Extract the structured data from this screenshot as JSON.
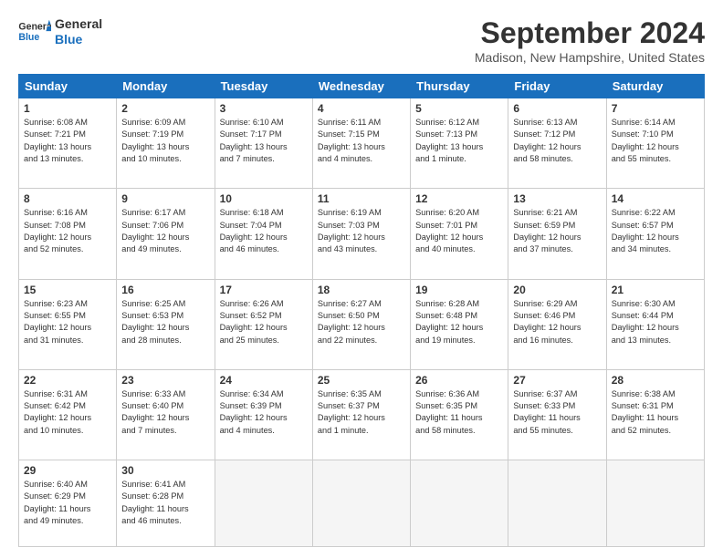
{
  "header": {
    "logo_line1": "General",
    "logo_line2": "Blue",
    "month_title": "September 2024",
    "location": "Madison, New Hampshire, United States"
  },
  "days_of_week": [
    "Sunday",
    "Monday",
    "Tuesday",
    "Wednesday",
    "Thursday",
    "Friday",
    "Saturday"
  ],
  "weeks": [
    [
      {
        "day": 1,
        "data": "Sunrise: 6:08 AM\nSunset: 7:21 PM\nDaylight: 13 hours\nand 13 minutes."
      },
      {
        "day": 2,
        "data": "Sunrise: 6:09 AM\nSunset: 7:19 PM\nDaylight: 13 hours\nand 10 minutes."
      },
      {
        "day": 3,
        "data": "Sunrise: 6:10 AM\nSunset: 7:17 PM\nDaylight: 13 hours\nand 7 minutes."
      },
      {
        "day": 4,
        "data": "Sunrise: 6:11 AM\nSunset: 7:15 PM\nDaylight: 13 hours\nand 4 minutes."
      },
      {
        "day": 5,
        "data": "Sunrise: 6:12 AM\nSunset: 7:13 PM\nDaylight: 13 hours\nand 1 minute."
      },
      {
        "day": 6,
        "data": "Sunrise: 6:13 AM\nSunset: 7:12 PM\nDaylight: 12 hours\nand 58 minutes."
      },
      {
        "day": 7,
        "data": "Sunrise: 6:14 AM\nSunset: 7:10 PM\nDaylight: 12 hours\nand 55 minutes."
      }
    ],
    [
      {
        "day": 8,
        "data": "Sunrise: 6:16 AM\nSunset: 7:08 PM\nDaylight: 12 hours\nand 52 minutes."
      },
      {
        "day": 9,
        "data": "Sunrise: 6:17 AM\nSunset: 7:06 PM\nDaylight: 12 hours\nand 49 minutes."
      },
      {
        "day": 10,
        "data": "Sunrise: 6:18 AM\nSunset: 7:04 PM\nDaylight: 12 hours\nand 46 minutes."
      },
      {
        "day": 11,
        "data": "Sunrise: 6:19 AM\nSunset: 7:03 PM\nDaylight: 12 hours\nand 43 minutes."
      },
      {
        "day": 12,
        "data": "Sunrise: 6:20 AM\nSunset: 7:01 PM\nDaylight: 12 hours\nand 40 minutes."
      },
      {
        "day": 13,
        "data": "Sunrise: 6:21 AM\nSunset: 6:59 PM\nDaylight: 12 hours\nand 37 minutes."
      },
      {
        "day": 14,
        "data": "Sunrise: 6:22 AM\nSunset: 6:57 PM\nDaylight: 12 hours\nand 34 minutes."
      }
    ],
    [
      {
        "day": 15,
        "data": "Sunrise: 6:23 AM\nSunset: 6:55 PM\nDaylight: 12 hours\nand 31 minutes."
      },
      {
        "day": 16,
        "data": "Sunrise: 6:25 AM\nSunset: 6:53 PM\nDaylight: 12 hours\nand 28 minutes."
      },
      {
        "day": 17,
        "data": "Sunrise: 6:26 AM\nSunset: 6:52 PM\nDaylight: 12 hours\nand 25 minutes."
      },
      {
        "day": 18,
        "data": "Sunrise: 6:27 AM\nSunset: 6:50 PM\nDaylight: 12 hours\nand 22 minutes."
      },
      {
        "day": 19,
        "data": "Sunrise: 6:28 AM\nSunset: 6:48 PM\nDaylight: 12 hours\nand 19 minutes."
      },
      {
        "day": 20,
        "data": "Sunrise: 6:29 AM\nSunset: 6:46 PM\nDaylight: 12 hours\nand 16 minutes."
      },
      {
        "day": 21,
        "data": "Sunrise: 6:30 AM\nSunset: 6:44 PM\nDaylight: 12 hours\nand 13 minutes."
      }
    ],
    [
      {
        "day": 22,
        "data": "Sunrise: 6:31 AM\nSunset: 6:42 PM\nDaylight: 12 hours\nand 10 minutes."
      },
      {
        "day": 23,
        "data": "Sunrise: 6:33 AM\nSunset: 6:40 PM\nDaylight: 12 hours\nand 7 minutes."
      },
      {
        "day": 24,
        "data": "Sunrise: 6:34 AM\nSunset: 6:39 PM\nDaylight: 12 hours\nand 4 minutes."
      },
      {
        "day": 25,
        "data": "Sunrise: 6:35 AM\nSunset: 6:37 PM\nDaylight: 12 hours\nand 1 minute."
      },
      {
        "day": 26,
        "data": "Sunrise: 6:36 AM\nSunset: 6:35 PM\nDaylight: 11 hours\nand 58 minutes."
      },
      {
        "day": 27,
        "data": "Sunrise: 6:37 AM\nSunset: 6:33 PM\nDaylight: 11 hours\nand 55 minutes."
      },
      {
        "day": 28,
        "data": "Sunrise: 6:38 AM\nSunset: 6:31 PM\nDaylight: 11 hours\nand 52 minutes."
      }
    ],
    [
      {
        "day": 29,
        "data": "Sunrise: 6:40 AM\nSunset: 6:29 PM\nDaylight: 11 hours\nand 49 minutes."
      },
      {
        "day": 30,
        "data": "Sunrise: 6:41 AM\nSunset: 6:28 PM\nDaylight: 11 hours\nand 46 minutes."
      },
      null,
      null,
      null,
      null,
      null
    ]
  ]
}
